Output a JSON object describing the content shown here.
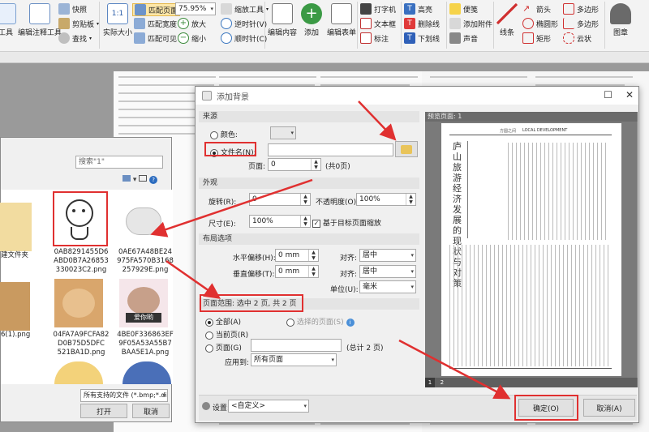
{
  "ribbon": {
    "left_labels": [
      "工具",
      "编辑注释工具"
    ],
    "snapshot": "快照",
    "clipboard": "剪贴板",
    "find": "查找",
    "actual_size": "实际大小",
    "fit_page": "匹配页面",
    "fit_width": "匹配宽度",
    "fit_visible": "匹配可见",
    "zoom_value": "75.95%",
    "zoom_in": "放大",
    "zoom_out": "缩小",
    "zoom_tool": "缩放工具",
    "rotate_left": "逆时针(V)",
    "rotate_right": "顺时针(C)",
    "edit_content": "编辑内容",
    "add": "添加",
    "edit_form": "编辑表单",
    "typewriter": "打字机",
    "textbox": "文本框",
    "callout": "标注",
    "highlight": "高亮",
    "strikeout": "删除线",
    "underline": "下划线",
    "note": "便笺",
    "add_attachment": "添加附件",
    "sound": "声音",
    "arrow": "箭头",
    "line": "线条",
    "ellipse": "椭圆形",
    "rectangle": "矩形",
    "polygon": "多边形",
    "polyline": "多边形",
    "cloud": "云状",
    "stamp": "图章"
  },
  "dialog": {
    "title": "添加背景",
    "source_header": "来源",
    "color_label": "颜色:",
    "file_label": "文件名(N):",
    "file_value": "",
    "page_label": "页面:",
    "page_value": "0",
    "page_total": "(共0页)",
    "appearance_header": "外观",
    "rotation_label": "旋转(R):",
    "rotation_value": "0",
    "opacity_label": "不透明度(O):",
    "opacity_value": "100%",
    "size_label": "尺寸(E):",
    "size_value": "100%",
    "scale_checkbox": "基于目标页面缩放",
    "layout_header": "布局选项",
    "h_offset_label": "水平偏移(H):",
    "h_offset_value": "0 mm",
    "v_offset_label": "垂直偏移(T):",
    "v_offset_value": "0 mm",
    "align_label_1": "对齐:",
    "align_value_1": "居中",
    "align_label_2": "对齐:",
    "align_value_2": "居中",
    "unit_label": "单位(U):",
    "unit_value": "毫米",
    "page_range_header": "页面范围: 选中 2 页, 共 2 页",
    "all_label": "全部(A)",
    "selected_pages_label": "选择的页面(S)",
    "current_page_label": "当前页(R)",
    "pages_label": "页面(G)",
    "pages_total": "(总计 2 页)",
    "apply_to_label": "应用到:",
    "apply_to_value": "所有页面",
    "preview_header": "预览页面: 1",
    "settings_label": "设置:",
    "settings_value": "<自定义>",
    "ok_label": "确定(O)",
    "cancel_label": "取消(A)",
    "preview_page_nums": [
      "1",
      "2"
    ]
  },
  "preview_doc": {
    "journal_tag": "LOCAL DEVELOPMENT",
    "section_tag": "方圆之间",
    "title": "庐山旅游经济发展的现状与对策"
  },
  "file_dialog": {
    "search_placeholder": "搜索\"1\"",
    "new_folder": "建文件夹",
    "files": [
      "0AB8291455D6ABD0B7A26853330023C2.png",
      "0AE67A48BE24975FA570B3168257929E.png",
      "6(1).png",
      "04FA7A9FCFA82D0B75D5DFC521BA1D.png",
      "4BE0F336863EF9F05A53A55B7BAA5E1A.png"
    ],
    "file_labels": [
      [
        "0AB8291455D6",
        "ABD0B7A26853",
        "330023C2.png"
      ],
      [
        "0AE67A48BE24",
        "975FA570B3168",
        "257929E.png"
      ],
      [
        "6(1).png"
      ],
      [
        "04FA7A9FCFA82",
        "D0B75D5DFC",
        "521BA1D.png"
      ],
      [
        "4BE0F336863EF",
        "9F05A53A55B7",
        "BAA5E1A.png"
      ]
    ],
    "sticker_text": "爱你哟",
    "filetype_value": "所有支持的文件 (*.bmp;*.dib;*",
    "open_label": "打开",
    "cancel_label": "取消"
  },
  "colors": {
    "annotation_red": "#e03030",
    "ribbon_bg": "#f3f3f3",
    "dialog_bg": "#f0f0f0"
  }
}
